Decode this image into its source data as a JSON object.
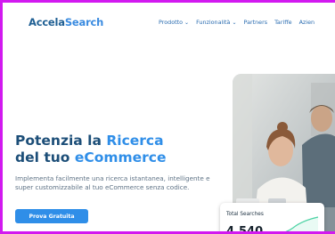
{
  "header": {
    "logo_main": "Accela",
    "logo_accent": "Search",
    "nav": [
      {
        "label": "Prodotto",
        "chevron": true
      },
      {
        "label": "Funzionalità",
        "chevron": true
      },
      {
        "label": "Partners",
        "chevron": false
      },
      {
        "label": "Tariffe",
        "chevron": false
      },
      {
        "label": "Azien",
        "chevron": false
      }
    ]
  },
  "hero": {
    "title_line1_prefix": "Potenzia la ",
    "title_line1_highlight": "Ricerca",
    "title_line2_prefix": "del tuo ",
    "title_line2_highlight": "eCommerce",
    "subtitle": "Implementa facilmente una ricerca istantanea, intelligente e super customizzabile al tuo eCommerce senza codice.",
    "cta_label": "Prova Gratuita"
  },
  "stats_card": {
    "label": "Total Searches",
    "value": "4,540"
  },
  "colors": {
    "accent": "#2f8ee8",
    "brand": "#1c4e78",
    "frame": "#d219f0"
  }
}
